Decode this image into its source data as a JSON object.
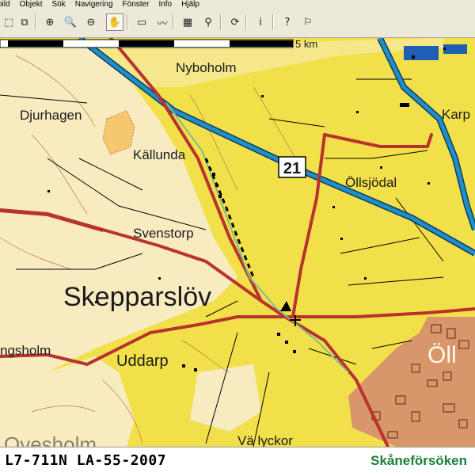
{
  "menu": [
    "bild",
    "Objekt",
    "Sök",
    "Navigering",
    "Fönster",
    "Info",
    "Hjälp"
  ],
  "toolbar": {
    "tools": [
      {
        "name": "select-icon",
        "glyph": "⬚"
      },
      {
        "name": "copy-icon",
        "glyph": "⧉"
      },
      {
        "name": "zoom-in-icon",
        "glyph": "⊕"
      },
      {
        "name": "zoom-icon",
        "glyph": "🔍"
      },
      {
        "name": "zoom-out-icon",
        "glyph": "⊖"
      },
      {
        "name": "pan-hand-icon",
        "glyph": "✋"
      },
      {
        "name": "zoom-window-icon",
        "glyph": "▭"
      },
      {
        "name": "measure-icon",
        "glyph": "〰"
      },
      {
        "name": "layers-icon",
        "glyph": "▦"
      },
      {
        "name": "search-map-icon",
        "glyph": "⚲"
      },
      {
        "name": "refresh-icon",
        "glyph": "⟳"
      },
      {
        "name": "info-icon",
        "glyph": "i"
      },
      {
        "name": "help-pointer-icon",
        "glyph": "?"
      },
      {
        "name": "gps-icon",
        "glyph": "⚐"
      }
    ]
  },
  "map": {
    "scale_label": "5 km",
    "road_number": "21",
    "places": {
      "nyboholm": "Nyboholm",
      "djurhagen": "Djurhagen",
      "kallunda": "Källunda",
      "karp": "Karp",
      "ollsjodal": "Öllsjödal",
      "svenstorp": "Svenstorp",
      "skepparslov": "Skepparslöv",
      "uddarp": "Uddarp",
      "ingsholm": "ngsholm",
      "ollsjo_town": "Öll",
      "valyckor": "Vä lyckor",
      "ovesholm": "Ovesholm"
    },
    "colors": {
      "open_land": "#f2e04a",
      "forest": "#f8ebc0",
      "urban": "#d9966a",
      "main_road": "#b8322e",
      "highway_blue": "#1f8fc4",
      "water": "#1e5fb5",
      "stream_green": "#7fbf8a"
    }
  },
  "status": {
    "sheet_code": "L7-711N LA-55-2007",
    "brand": "Skåneförsöken",
    "brand_color": "#1b7f3a"
  }
}
